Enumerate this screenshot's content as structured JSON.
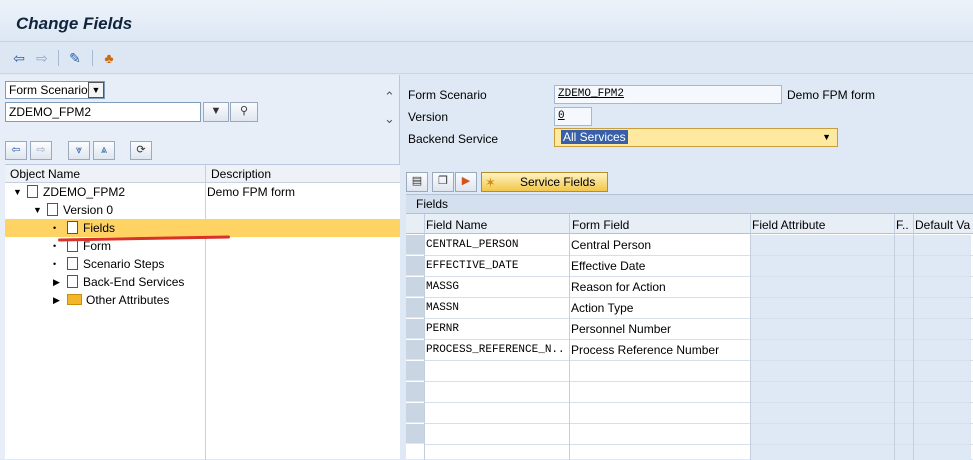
{
  "title": "Change Fields",
  "toolbar": {
    "icons": [
      "back-arrow-icon",
      "forward-arrow-icon",
      "edit-display-icon",
      "hierarchy-icon"
    ]
  },
  "left": {
    "object_type": "Form Scenario",
    "object_value": "ZDEMO_FPM2",
    "tree_headers": {
      "name": "Object Name",
      "description": "Description"
    },
    "tree": [
      {
        "label": "ZDEMO_FPM2",
        "desc": "Demo FPM form"
      },
      {
        "label": "Version 0",
        "desc": ""
      },
      {
        "label": "Fields",
        "desc": ""
      },
      {
        "label": "Form",
        "desc": ""
      },
      {
        "label": "Scenario Steps",
        "desc": ""
      },
      {
        "label": "Back-End Services",
        "desc": ""
      },
      {
        "label": "Other Attributes",
        "desc": ""
      }
    ]
  },
  "right": {
    "form_scenario_label": "Form Scenario",
    "form_scenario_value": "ZDEMO_FPM2",
    "form_scenario_desc": "Demo FPM form",
    "version_label": "Version",
    "version_value": "0",
    "backend_label": "Backend Service",
    "backend_value": "All Services",
    "service_fields_button": "Service Fields",
    "grid_title": "Fields",
    "columns": {
      "field_name": "Field Name",
      "form_field": "Form Field",
      "field_attribute": "Field Attribute",
      "f": "F..",
      "default": "Default Va"
    },
    "rows": [
      {
        "name": "CENTRAL_PERSON",
        "form": "Central Person"
      },
      {
        "name": "EFFECTIVE_DATE",
        "form": "Effective Date"
      },
      {
        "name": "MASSG",
        "form": "Reason for Action"
      },
      {
        "name": "MASSN",
        "form": "Action Type"
      },
      {
        "name": "PERNR",
        "form": "Personnel Number"
      },
      {
        "name": "PROCESS_REFERENCE_N..",
        "form": "Process Reference Number"
      }
    ]
  },
  "colors": {
    "selection": "#ffd363",
    "accent": "#2a5da8",
    "dropdown_bg": "#fde99f"
  }
}
